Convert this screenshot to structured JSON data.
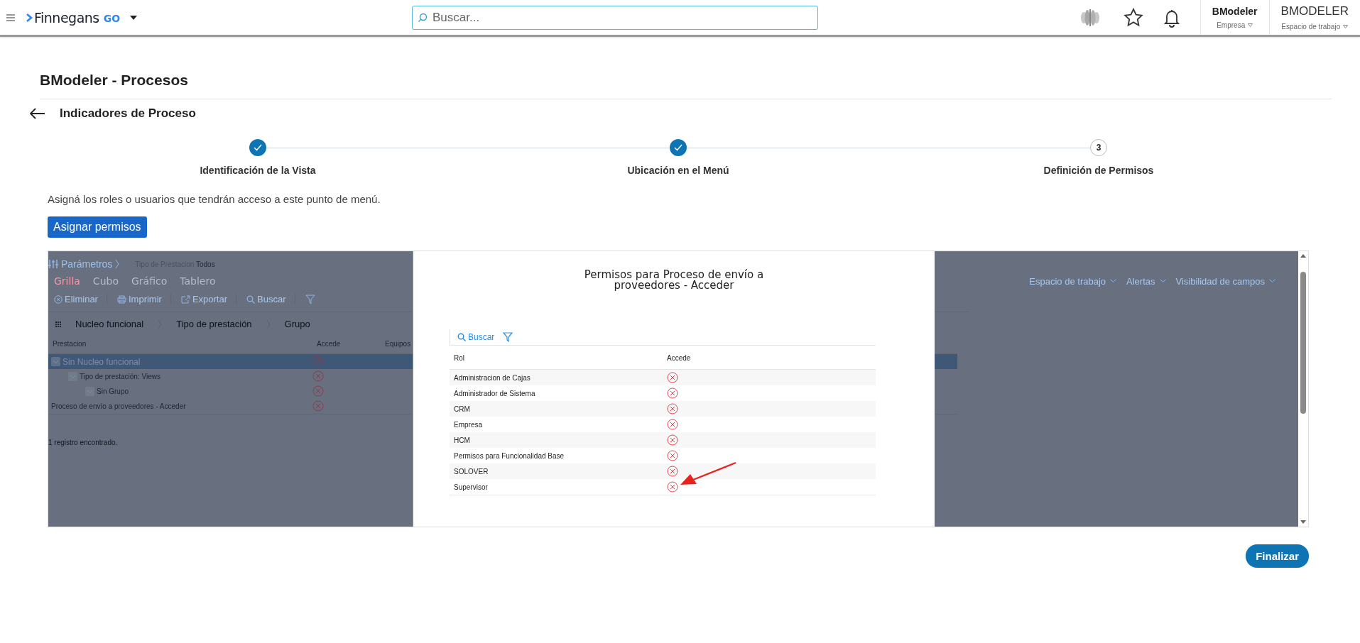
{
  "topbar": {
    "brand": "Finnegans",
    "brand_suffix": "GO",
    "search": {
      "placeholder": "Buscar..."
    },
    "company": {
      "name": "BModeler",
      "label": "Empresa"
    },
    "workspace": {
      "name": "BMODELER",
      "label": "Espacio de trabajo"
    }
  },
  "page": {
    "title": "BModeler - Procesos",
    "subtitle": "Indicadores de Proceso"
  },
  "steps": [
    {
      "label": "Identificación de la Vista",
      "completed": true
    },
    {
      "label": "Ubicación en el Menú",
      "completed": true
    },
    {
      "label": "Definición de Permisos",
      "completed": false,
      "number": "3"
    }
  ],
  "description": "Asigná los roles o usuarios que tendrán acceso a este punto de menú.",
  "assign_button": "Asignar permisos",
  "embedded": {
    "params": {
      "label": "Parámetros",
      "filter_label": "Tipo de Prestacion",
      "filter_value": "Todos"
    },
    "views": [
      {
        "label": "Grilla",
        "selected": true
      },
      {
        "label": "Cubo",
        "selected": false
      },
      {
        "label": "Gráfico",
        "selected": false
      },
      {
        "label": "Tablero",
        "selected": false
      }
    ],
    "toolbar": [
      {
        "kind": "delete",
        "label": "Eliminar"
      },
      {
        "kind": "print",
        "label": "Imprimir"
      },
      {
        "kind": "export",
        "label": "Exportar"
      },
      {
        "kind": "search",
        "label": "Buscar"
      },
      {
        "kind": "filter"
      }
    ],
    "menus": [
      "Espacio de trabajo",
      "Alertas",
      "Visibilidad de campos"
    ],
    "grouping": [
      "Nucleo funcional",
      "Tipo de prestación",
      "Grupo"
    ],
    "columns": [
      "Prestacion",
      "Accede",
      "Equipos"
    ],
    "rows": [
      {
        "kind": "group",
        "label": "Sin Nucleo funcional",
        "access": false,
        "selected": true,
        "children": [
          {
            "kind": "group",
            "label": "Tipo de prestación: Views",
            "access": false,
            "selected": false,
            "children": [
              {
                "kind": "group",
                "label": "Sin Grupo",
                "access": false,
                "selected": false
              }
            ]
          }
        ]
      },
      {
        "kind": "record",
        "label": "Proceso de envío a proveedores - Acceder",
        "access": false,
        "selected": false
      }
    ],
    "footer": "1 registro encontrado."
  },
  "modal": {
    "title_lines": [
      "Permisos para Proceso de envío a",
      "proveedores - Acceder"
    ],
    "search_label": "Buscar",
    "columns": [
      "Rol",
      "Accede"
    ],
    "rows": [
      {
        "role": "Administracion de Cajas",
        "access": false
      },
      {
        "role": "Administrador de Sistema",
        "access": false
      },
      {
        "role": "CRM",
        "access": false
      },
      {
        "role": "Empresa",
        "access": false
      },
      {
        "role": "HCM",
        "access": false
      },
      {
        "role": "Permisos para Funcionalidad Base",
        "access": false
      },
      {
        "role": "SOLOVER",
        "access": false
      },
      {
        "role": "Supervisor",
        "access": false
      }
    ]
  },
  "finish_button": "Finalizar"
}
